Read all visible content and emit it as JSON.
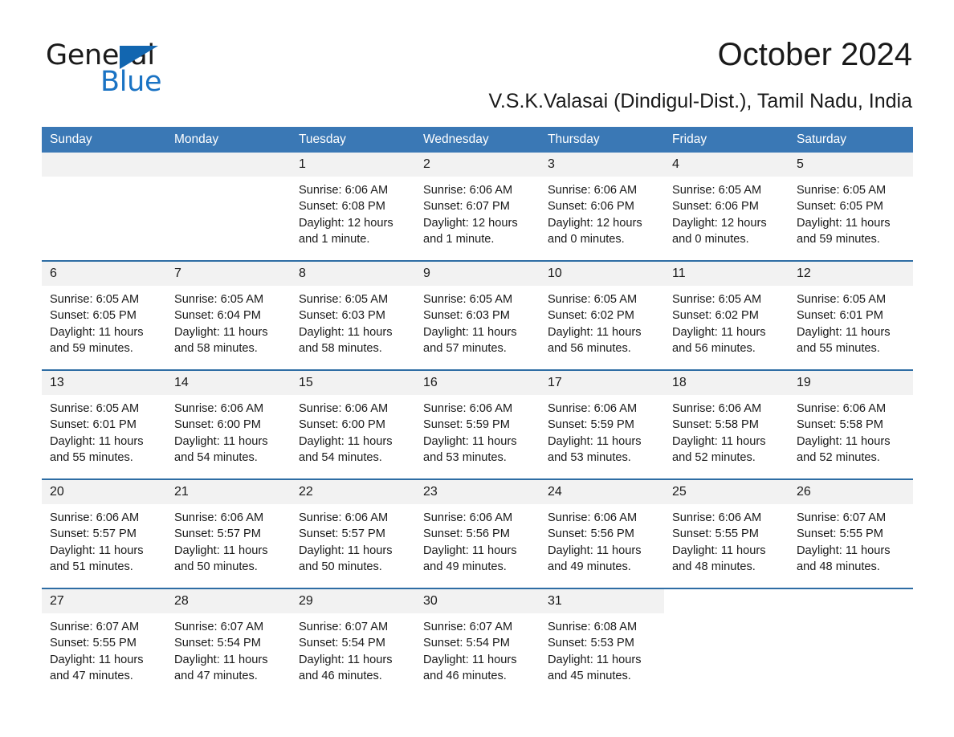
{
  "brand": {
    "name_part1": "General",
    "name_part2": "Blue",
    "logo_color": "#1266b0",
    "accent_color": "#3a78b5"
  },
  "header": {
    "title": "October 2024",
    "subtitle": "V.S.K.Valasai (Dindigul-Dist.), Tamil Nadu, India"
  },
  "calendar": {
    "weekday_headers": [
      "Sunday",
      "Monday",
      "Tuesday",
      "Wednesday",
      "Thursday",
      "Friday",
      "Saturday"
    ],
    "weeks": [
      [
        {
          "day": "",
          "empty": true
        },
        {
          "day": "",
          "empty": true
        },
        {
          "day": "1",
          "sunrise": "Sunrise: 6:06 AM",
          "sunset": "Sunset: 6:08 PM",
          "daylight_line1": "Daylight: 12 hours",
          "daylight_line2": "and 1 minute."
        },
        {
          "day": "2",
          "sunrise": "Sunrise: 6:06 AM",
          "sunset": "Sunset: 6:07 PM",
          "daylight_line1": "Daylight: 12 hours",
          "daylight_line2": "and 1 minute."
        },
        {
          "day": "3",
          "sunrise": "Sunrise: 6:06 AM",
          "sunset": "Sunset: 6:06 PM",
          "daylight_line1": "Daylight: 12 hours",
          "daylight_line2": "and 0 minutes."
        },
        {
          "day": "4",
          "sunrise": "Sunrise: 6:05 AM",
          "sunset": "Sunset: 6:06 PM",
          "daylight_line1": "Daylight: 12 hours",
          "daylight_line2": "and 0 minutes."
        },
        {
          "day": "5",
          "sunrise": "Sunrise: 6:05 AM",
          "sunset": "Sunset: 6:05 PM",
          "daylight_line1": "Daylight: 11 hours",
          "daylight_line2": "and 59 minutes."
        }
      ],
      [
        {
          "day": "6",
          "sunrise": "Sunrise: 6:05 AM",
          "sunset": "Sunset: 6:05 PM",
          "daylight_line1": "Daylight: 11 hours",
          "daylight_line2": "and 59 minutes."
        },
        {
          "day": "7",
          "sunrise": "Sunrise: 6:05 AM",
          "sunset": "Sunset: 6:04 PM",
          "daylight_line1": "Daylight: 11 hours",
          "daylight_line2": "and 58 minutes."
        },
        {
          "day": "8",
          "sunrise": "Sunrise: 6:05 AM",
          "sunset": "Sunset: 6:03 PM",
          "daylight_line1": "Daylight: 11 hours",
          "daylight_line2": "and 58 minutes."
        },
        {
          "day": "9",
          "sunrise": "Sunrise: 6:05 AM",
          "sunset": "Sunset: 6:03 PM",
          "daylight_line1": "Daylight: 11 hours",
          "daylight_line2": "and 57 minutes."
        },
        {
          "day": "10",
          "sunrise": "Sunrise: 6:05 AM",
          "sunset": "Sunset: 6:02 PM",
          "daylight_line1": "Daylight: 11 hours",
          "daylight_line2": "and 56 minutes."
        },
        {
          "day": "11",
          "sunrise": "Sunrise: 6:05 AM",
          "sunset": "Sunset: 6:02 PM",
          "daylight_line1": "Daylight: 11 hours",
          "daylight_line2": "and 56 minutes."
        },
        {
          "day": "12",
          "sunrise": "Sunrise: 6:05 AM",
          "sunset": "Sunset: 6:01 PM",
          "daylight_line1": "Daylight: 11 hours",
          "daylight_line2": "and 55 minutes."
        }
      ],
      [
        {
          "day": "13",
          "sunrise": "Sunrise: 6:05 AM",
          "sunset": "Sunset: 6:01 PM",
          "daylight_line1": "Daylight: 11 hours",
          "daylight_line2": "and 55 minutes."
        },
        {
          "day": "14",
          "sunrise": "Sunrise: 6:06 AM",
          "sunset": "Sunset: 6:00 PM",
          "daylight_line1": "Daylight: 11 hours",
          "daylight_line2": "and 54 minutes."
        },
        {
          "day": "15",
          "sunrise": "Sunrise: 6:06 AM",
          "sunset": "Sunset: 6:00 PM",
          "daylight_line1": "Daylight: 11 hours",
          "daylight_line2": "and 54 minutes."
        },
        {
          "day": "16",
          "sunrise": "Sunrise: 6:06 AM",
          "sunset": "Sunset: 5:59 PM",
          "daylight_line1": "Daylight: 11 hours",
          "daylight_line2": "and 53 minutes."
        },
        {
          "day": "17",
          "sunrise": "Sunrise: 6:06 AM",
          "sunset": "Sunset: 5:59 PM",
          "daylight_line1": "Daylight: 11 hours",
          "daylight_line2": "and 53 minutes."
        },
        {
          "day": "18",
          "sunrise": "Sunrise: 6:06 AM",
          "sunset": "Sunset: 5:58 PM",
          "daylight_line1": "Daylight: 11 hours",
          "daylight_line2": "and 52 minutes."
        },
        {
          "day": "19",
          "sunrise": "Sunrise: 6:06 AM",
          "sunset": "Sunset: 5:58 PM",
          "daylight_line1": "Daylight: 11 hours",
          "daylight_line2": "and 52 minutes."
        }
      ],
      [
        {
          "day": "20",
          "sunrise": "Sunrise: 6:06 AM",
          "sunset": "Sunset: 5:57 PM",
          "daylight_line1": "Daylight: 11 hours",
          "daylight_line2": "and 51 minutes."
        },
        {
          "day": "21",
          "sunrise": "Sunrise: 6:06 AM",
          "sunset": "Sunset: 5:57 PM",
          "daylight_line1": "Daylight: 11 hours",
          "daylight_line2": "and 50 minutes."
        },
        {
          "day": "22",
          "sunrise": "Sunrise: 6:06 AM",
          "sunset": "Sunset: 5:57 PM",
          "daylight_line1": "Daylight: 11 hours",
          "daylight_line2": "and 50 minutes."
        },
        {
          "day": "23",
          "sunrise": "Sunrise: 6:06 AM",
          "sunset": "Sunset: 5:56 PM",
          "daylight_line1": "Daylight: 11 hours",
          "daylight_line2": "and 49 minutes."
        },
        {
          "day": "24",
          "sunrise": "Sunrise: 6:06 AM",
          "sunset": "Sunset: 5:56 PM",
          "daylight_line1": "Daylight: 11 hours",
          "daylight_line2": "and 49 minutes."
        },
        {
          "day": "25",
          "sunrise": "Sunrise: 6:06 AM",
          "sunset": "Sunset: 5:55 PM",
          "daylight_line1": "Daylight: 11 hours",
          "daylight_line2": "and 48 minutes."
        },
        {
          "day": "26",
          "sunrise": "Sunrise: 6:07 AM",
          "sunset": "Sunset: 5:55 PM",
          "daylight_line1": "Daylight: 11 hours",
          "daylight_line2": "and 48 minutes."
        }
      ],
      [
        {
          "day": "27",
          "sunrise": "Sunrise: 6:07 AM",
          "sunset": "Sunset: 5:55 PM",
          "daylight_line1": "Daylight: 11 hours",
          "daylight_line2": "and 47 minutes."
        },
        {
          "day": "28",
          "sunrise": "Sunrise: 6:07 AM",
          "sunset": "Sunset: 5:54 PM",
          "daylight_line1": "Daylight: 11 hours",
          "daylight_line2": "and 47 minutes."
        },
        {
          "day": "29",
          "sunrise": "Sunrise: 6:07 AM",
          "sunset": "Sunset: 5:54 PM",
          "daylight_line1": "Daylight: 11 hours",
          "daylight_line2": "and 46 minutes."
        },
        {
          "day": "30",
          "sunrise": "Sunrise: 6:07 AM",
          "sunset": "Sunset: 5:54 PM",
          "daylight_line1": "Daylight: 11 hours",
          "daylight_line2": "and 46 minutes."
        },
        {
          "day": "31",
          "sunrise": "Sunrise: 6:08 AM",
          "sunset": "Sunset: 5:53 PM",
          "daylight_line1": "Daylight: 11 hours",
          "daylight_line2": "and 45 minutes."
        },
        {
          "day": "",
          "empty": true,
          "no_band": true
        },
        {
          "day": "",
          "empty": true,
          "no_band": true
        }
      ]
    ]
  }
}
